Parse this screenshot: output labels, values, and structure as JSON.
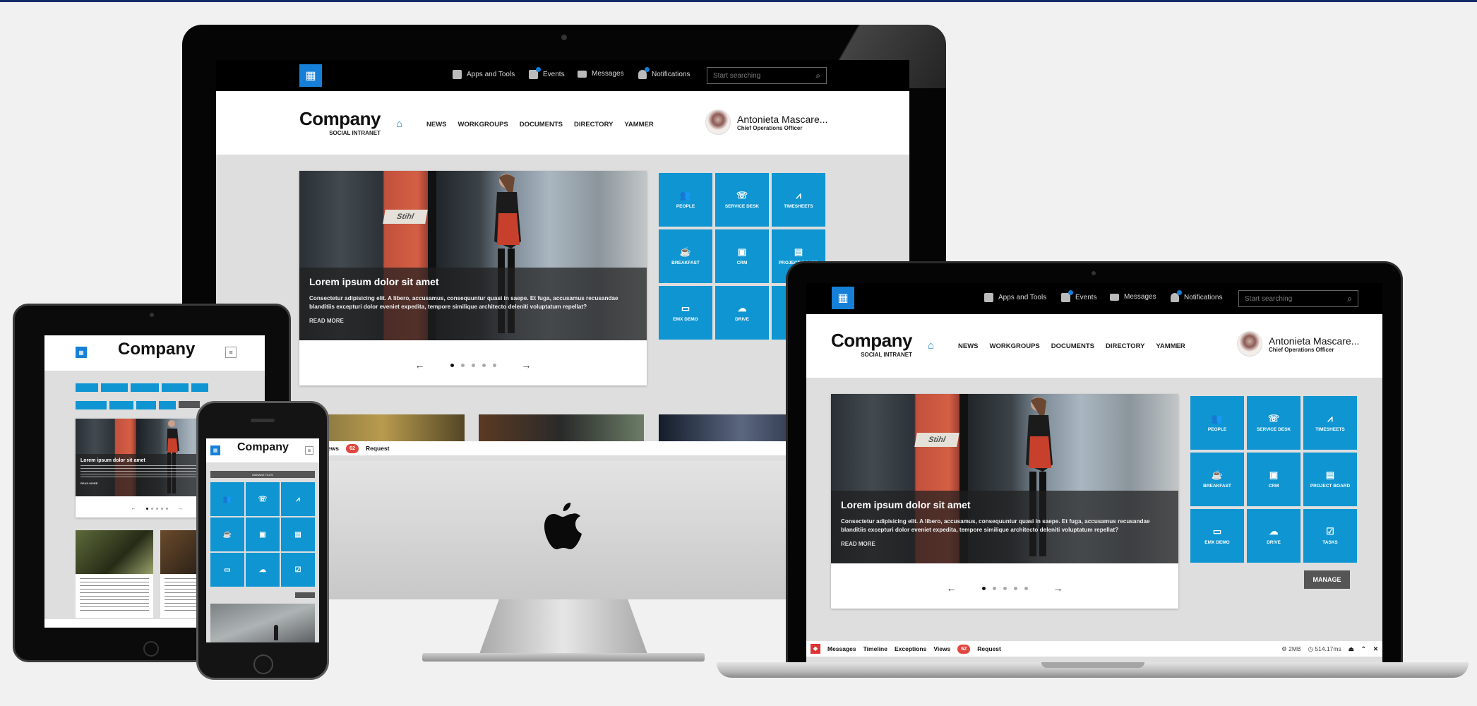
{
  "topbar": {
    "apps_label": "Apps and Tools",
    "events_label": "Events",
    "messages_label": "Messages",
    "notifications_label": "Notifications",
    "search_placeholder": "Start searching"
  },
  "header": {
    "brand": "Company",
    "brand_sub": "SOCIAL INTRANET",
    "nav": [
      "NEWS",
      "WORKGROUPS",
      "DOCUMENTS",
      "DIRECTORY",
      "YAMMER"
    ],
    "user_name": "Antonieta Mascare...",
    "user_role": "Chief Operations Officer"
  },
  "carousel": {
    "title": "Lorem ipsum dolor sit amet",
    "desc": "Consectetur adipisicing elit. A libero, accusamus, consequuntur quasi in saepe. Et fuga, accusamus recusandae blanditiis excepturi dolor eveniet expedita, tempore similique architecto deleniti voluptatum repellat?",
    "read_more": "READ MORE",
    "sign_text": "Stihl",
    "slides": 5,
    "active_slide": 1
  },
  "tiles": [
    {
      "label": "PEOPLE",
      "icon": "people-icon"
    },
    {
      "label": "SERVICE DESK",
      "icon": "phone-icon"
    },
    {
      "label": "TIMESHEETS",
      "icon": "chart-icon"
    },
    {
      "label": "BREAKFAST",
      "icon": "coffee-icon"
    },
    {
      "label": "CRM",
      "icon": "crm-icon"
    },
    {
      "label": "PROJECT BOARD",
      "icon": "board-icon"
    },
    {
      "label": "EMX DEMO",
      "icon": "devices-icon"
    },
    {
      "label": "DRIVE",
      "icon": "cloud-icon"
    },
    {
      "label": "TASKS",
      "icon": "check-icon"
    }
  ],
  "manage_label": "MANAGE",
  "debugbar": {
    "messages": "Messages",
    "timeline": "Timeline",
    "exceptions": "Exceptions",
    "views": "Views",
    "views_count": "62",
    "request": "Request",
    "memory": "2MB",
    "time": "514.17ms"
  },
  "phone": {
    "manage_label": "MANAGE TILES"
  },
  "colors": {
    "accent": "#1680d8",
    "tile": "#0e95d2",
    "topbar": "#000000",
    "views_badge": "#e0473e"
  }
}
